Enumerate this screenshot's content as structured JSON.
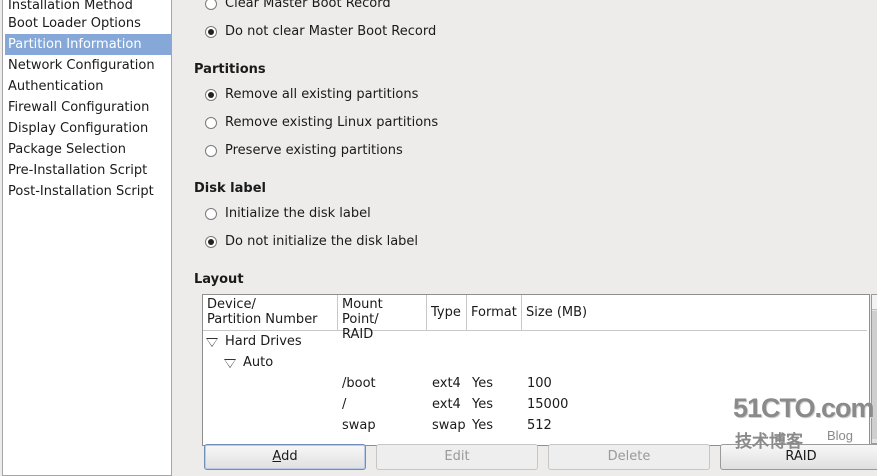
{
  "sidebar": {
    "items": [
      {
        "label": "Installation Method",
        "selected": false
      },
      {
        "label": "Boot Loader Options",
        "selected": false
      },
      {
        "label": "Partition Information",
        "selected": true
      },
      {
        "label": "Network Configuration",
        "selected": false
      },
      {
        "label": "Authentication",
        "selected": false
      },
      {
        "label": "Firewall Configuration",
        "selected": false
      },
      {
        "label": "Display Configuration",
        "selected": false
      },
      {
        "label": "Package Selection",
        "selected": false
      },
      {
        "label": "Pre-Installation Script",
        "selected": false
      },
      {
        "label": "Post-Installation Script",
        "selected": false
      }
    ]
  },
  "mbr": {
    "options": [
      {
        "label": "Clear Master Boot Record",
        "checked": false
      },
      {
        "label": "Do not clear Master Boot Record",
        "checked": true
      }
    ]
  },
  "partitions": {
    "title": "Partitions",
    "options": [
      {
        "label": "Remove all existing partitions",
        "checked": true
      },
      {
        "label": "Remove existing Linux partitions",
        "checked": false
      },
      {
        "label": "Preserve existing partitions",
        "checked": false
      }
    ]
  },
  "disk_label": {
    "title": "Disk label",
    "options": [
      {
        "label": "Initialize the disk label",
        "checked": false
      },
      {
        "label": "Do not initialize the disk label",
        "checked": true
      }
    ]
  },
  "layout": {
    "title": "Layout",
    "columns": {
      "device_line1": "Device/",
      "device_line2": "Partition Number",
      "mount_line1": "Mount Point/",
      "mount_line2": "RAID",
      "type": "Type",
      "format": "Format",
      "size": "Size (MB)"
    },
    "tree": {
      "hard_drives": "Hard Drives",
      "auto": "Auto"
    },
    "rows": [
      {
        "mount": "/boot",
        "type": "ext4",
        "format": "Yes",
        "size": "100"
      },
      {
        "mount": "/",
        "type": "ext4",
        "format": "Yes",
        "size": "15000"
      },
      {
        "mount": "swap",
        "type": "swap",
        "format": "Yes",
        "size": "512"
      }
    ]
  },
  "buttons": {
    "add_accel": "A",
    "add_rest": "dd",
    "edit": "Edit",
    "delete": "Delete",
    "raid": "RAID"
  },
  "watermark": {
    "big": "51CTO.com",
    "small": "技术博客",
    "blog": "Blog"
  },
  "colors": {
    "selection": "#86a8d8",
    "window_bg": "#edeceb"
  }
}
